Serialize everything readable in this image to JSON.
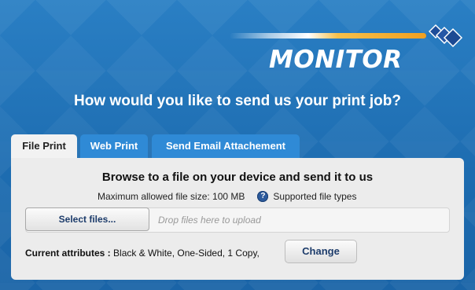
{
  "brand": {
    "name": "MONITOR"
  },
  "question": "How would you like to send us your print job?",
  "tabs": [
    {
      "label": "File Print",
      "active": true
    },
    {
      "label": "Web Print",
      "active": false
    },
    {
      "label": "Send Email Attachement",
      "active": false
    }
  ],
  "panel": {
    "title": "Browse to a file on your device and send it to us",
    "max_size": "Maximum allowed file size: 100 MB",
    "supported_types": "Supported file types",
    "select_files_label": "Select files...",
    "drop_hint": "Drop files here to upload",
    "attributes_label": "Current attributes :",
    "attributes_value": "Black & White, One-Sided, 1 Copy,",
    "change_label": "Change"
  },
  "colors": {
    "background": "#1d6fb4",
    "active_tab": "#f2f2f2",
    "inactive_tab": "#2f8ad6",
    "accent_orange": "#f0a020"
  },
  "icons": {
    "help": "question-circle-icon",
    "logo": "diamond-logo-icon"
  }
}
